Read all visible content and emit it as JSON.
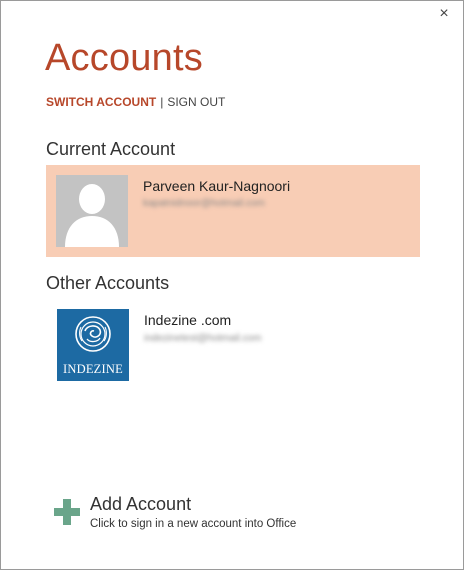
{
  "dialog": {
    "close_glyph": "×",
    "close_icon": "close-icon",
    "title": "Accounts",
    "actions": {
      "switch_account": "SWITCH ACCOUNT",
      "separator": "|",
      "sign_out": "SIGN OUT"
    }
  },
  "current_account": {
    "heading": "Current Account",
    "name": "Parveen Kaur-Nagnoori",
    "email": "kapatnidnoor@hotmail.com",
    "avatar_icon": "default-user-avatar",
    "highlight_color": "#f8cdb5"
  },
  "other_accounts": {
    "heading": "Other Accounts",
    "items": [
      {
        "name": "Indezine .com",
        "email": "indezinetest@hotmail.com",
        "logo_text": "INDEZINE",
        "logo_color": "#1d6aa3"
      }
    ]
  },
  "add_account": {
    "label": "Add Account",
    "description": "Click to sign in a new account into Office",
    "icon": "plus-icon",
    "icon_color": "#6aa58a"
  },
  "colors": {
    "accent": "#b7472a"
  }
}
